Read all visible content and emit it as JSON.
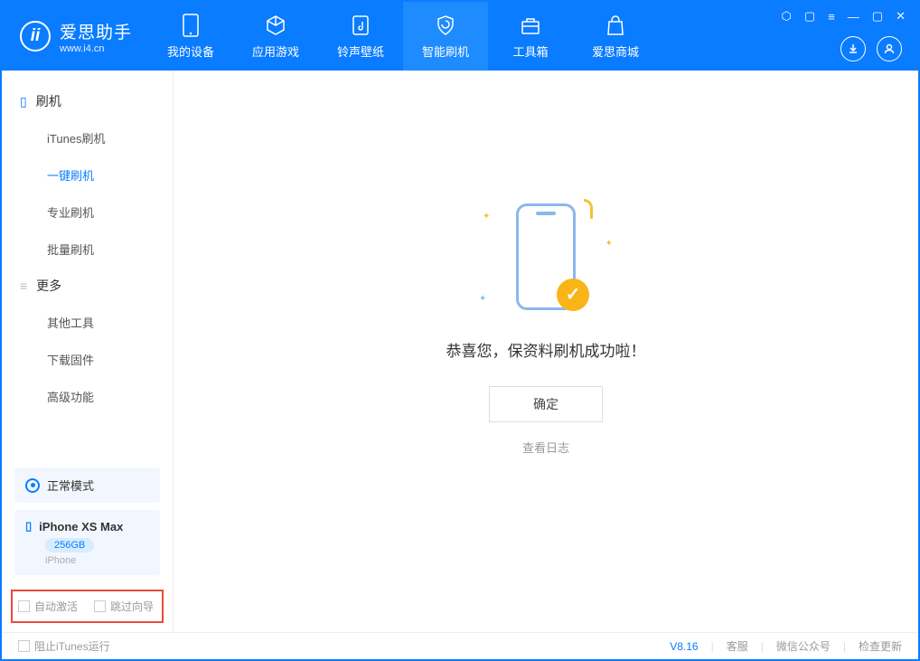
{
  "app": {
    "title": "爱思助手",
    "subtitle": "www.i4.cn"
  },
  "tabs": [
    {
      "label": "我的设备"
    },
    {
      "label": "应用游戏"
    },
    {
      "label": "铃声壁纸"
    },
    {
      "label": "智能刷机"
    },
    {
      "label": "工具箱"
    },
    {
      "label": "爱思商城"
    }
  ],
  "sidebar": {
    "section1": "刷机",
    "items1": [
      "iTunes刷机",
      "一键刷机",
      "专业刷机",
      "批量刷机"
    ],
    "section2": "更多",
    "items2": [
      "其他工具",
      "下载固件",
      "高级功能"
    ]
  },
  "mode": {
    "label": "正常模式"
  },
  "device": {
    "name": "iPhone XS Max",
    "storage": "256GB",
    "type": "iPhone"
  },
  "checks": {
    "auto_activate": "自动激活",
    "skip_guide": "跳过向导"
  },
  "main": {
    "message": "恭喜您，保资料刷机成功啦！",
    "ok": "确定",
    "view_log": "查看日志"
  },
  "footer": {
    "block_itunes": "阻止iTunes运行",
    "version": "V8.16",
    "support": "客服",
    "wechat": "微信公众号",
    "update": "检查更新"
  }
}
